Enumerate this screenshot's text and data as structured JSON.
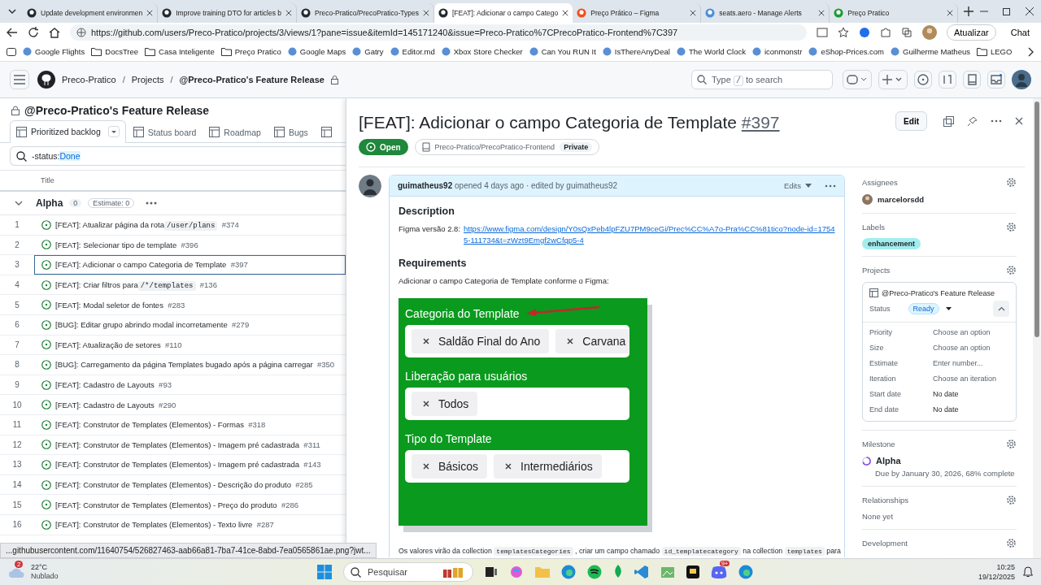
{
  "browser": {
    "tabs": [
      {
        "title": "Update development environmen",
        "kind": "github",
        "selected": false
      },
      {
        "title": "Improve training DTO for articles b",
        "kind": "github",
        "selected": false
      },
      {
        "title": "Preco-Pratico/PrecoPratico-Types",
        "kind": "github",
        "selected": false
      },
      {
        "title": "[FEAT]: Adicionar o campo Catego",
        "kind": "github",
        "selected": true
      },
      {
        "title": "Preço Prático – Figma",
        "kind": "figma",
        "selected": false
      },
      {
        "title": "seats.aero - Manage Alerts",
        "kind": "seats",
        "selected": false
      },
      {
        "title": "Preço Pratico",
        "kind": "preco",
        "selected": false
      }
    ],
    "url": "https://github.com/users/Preco-Pratico/projects/3/views/1?pane=issue&itemId=145171240&issue=Preco-Pratico%7CPrecoPratico-Frontend%7C397",
    "update_button": "Atualizar",
    "chat_button": "Chat",
    "bookmarks": [
      {
        "label": "Google Flights",
        "kind": "site"
      },
      {
        "label": "DocsTree",
        "kind": "folder"
      },
      {
        "label": "Casa Inteligente",
        "kind": "folder"
      },
      {
        "label": "Preço Pratico",
        "kind": "folder"
      },
      {
        "label": "Google Maps",
        "kind": "site"
      },
      {
        "label": "Gatry",
        "kind": "site"
      },
      {
        "label": "Editor.md",
        "kind": "site"
      },
      {
        "label": "Xbox Store Checker",
        "kind": "site"
      },
      {
        "label": "Can You RUN It",
        "kind": "site"
      },
      {
        "label": "IsThereAnyDeal",
        "kind": "site"
      },
      {
        "label": "The World Clock",
        "kind": "site"
      },
      {
        "label": "iconmonstr",
        "kind": "site"
      },
      {
        "label": "eShop-Prices.com",
        "kind": "site"
      },
      {
        "label": "Guilherme Matheus",
        "kind": "site"
      },
      {
        "label": "LEGO",
        "kind": "folder"
      }
    ]
  },
  "github": {
    "breadcrumbs": [
      {
        "kind": "link",
        "text": "Preco-Pratico"
      },
      {
        "kind": "separator",
        "text": "/"
      },
      {
        "kind": "link",
        "text": "Projects"
      },
      {
        "kind": "separator",
        "text": "/"
      },
      {
        "kind": "current",
        "text": "@Preco-Pratico's Feature Release"
      }
    ],
    "search": {
      "before": "Type",
      "key": "/",
      "after": "to search"
    }
  },
  "project": {
    "title": "@Preco-Pratico's Feature Release",
    "views": [
      {
        "label": "Prioritized backlog",
        "selected": true
      },
      {
        "label": "Status board",
        "selected": false
      },
      {
        "label": "Roadmap",
        "selected": false
      },
      {
        "label": "Bugs",
        "selected": false
      }
    ],
    "filter": {
      "prefix": "-status:",
      "value": "Done"
    },
    "column": "Title",
    "group": {
      "name": "Alpha",
      "count": "0",
      "estimate": "Estimate: 0"
    },
    "rows": [
      {
        "num": "1",
        "title": "[FEAT]: Atualizar página da rota",
        "code": "/user/plans",
        "number": "#374",
        "selected": false
      },
      {
        "num": "2",
        "title": "[FEAT]: Selecionar tipo de template",
        "number": "#396",
        "selected": false
      },
      {
        "num": "3",
        "title": "[FEAT]: Adicionar o campo Categoria de Template",
        "number": "#397",
        "selected": true
      },
      {
        "num": "4",
        "title": "[FEAT]: Criar filtros para",
        "code": "/*/templates",
        "number": "#136",
        "selected": false
      },
      {
        "num": "5",
        "title": "[FEAT]: Modal seletor de fontes",
        "number": "#283",
        "selected": false
      },
      {
        "num": "6",
        "title": "[BUG]: Editar grupo abrindo modal incorretamente",
        "number": "#279",
        "selected": false
      },
      {
        "num": "7",
        "title": "[FEAT]: Atualização de setores",
        "number": "#110",
        "selected": false
      },
      {
        "num": "8",
        "title": "[BUG]: Carregamento da página Templates bugado após a página carregar",
        "number": "#350",
        "selected": false
      },
      {
        "num": "9",
        "title": "[FEAT]: Cadastro de Layouts",
        "number": "#93",
        "selected": false
      },
      {
        "num": "10",
        "title": "[FEAT]: Cadastro de Layouts",
        "number": "#290",
        "selected": false
      },
      {
        "num": "11",
        "title": "[FEAT]: Construtor de Templates (Elementos) - Formas",
        "number": "#318",
        "selected": false
      },
      {
        "num": "12",
        "title": "[FEAT]: Construtor de Templates (Elementos) - Imagem pré cadastrada",
        "number": "#311",
        "selected": false
      },
      {
        "num": "13",
        "title": "[FEAT]: Construtor de Templates (Elementos) - Imagem pré cadastrada",
        "number": "#143",
        "selected": false
      },
      {
        "num": "14",
        "title": "[FEAT]: Construtor de Templates (Elementos) - Descrição do produto",
        "number": "#285",
        "selected": false
      },
      {
        "num": "15",
        "title": "[FEAT]: Construtor de Templates (Elementos) - Preço do produto",
        "number": "#286",
        "selected": false
      },
      {
        "num": "16",
        "title": "[FEAT]: Construtor de Templates (Elementos) - Texto livre",
        "number": "#287",
        "selected": false
      }
    ]
  },
  "issue": {
    "title": "[FEAT]: Adicionar o campo Categoria de Template",
    "number": "#397",
    "edit_button": "Edit",
    "state": "Open",
    "repo": "Preco-Pratico/PrecoPratico-Frontend",
    "visibility": "Private",
    "comment": {
      "author": "guimatheus92",
      "meta": "opened 4 days ago · edited by guimatheus92",
      "edits": "Edits",
      "description_heading": "Description",
      "figma_label": "Figma versão 2.8:",
      "figma_link": "https://www.figma.com/design/Y0sQxPeb4lpFZU7PM9ceGi/Prec%CC%A7o-Pra%CC%81tico?node-id=17545-111734&t=zWzt9Emgf2wCfqp5-4",
      "requirements_heading": "Requirements",
      "requirements_text": "Adicionar o campo Categoria de Template conforme o Figma:",
      "mockup": [
        {
          "label": "Categoria do Template",
          "chips": [
            "Saldão Final do Ano",
            "Carvana"
          ]
        },
        {
          "label": "Liberação para usuários",
          "chips": [
            "Todos"
          ]
        },
        {
          "label": "Tipo do Template",
          "chips": [
            "Básicos",
            "Intermediários"
          ]
        }
      ],
      "footer": [
        {
          "kind": "text",
          "text": "Os valores virão da collection "
        },
        {
          "kind": "code",
          "text": "templatesCategories"
        },
        {
          "kind": "text",
          "text": " , criar um campo chamado "
        },
        {
          "kind": "code",
          "text": "id_templatecategory"
        },
        {
          "kind": "text",
          "text": " na collection "
        },
        {
          "kind": "code",
          "text": "templates"
        },
        {
          "kind": "text",
          "text": " para"
        }
      ]
    },
    "sidebar": {
      "assignees_heading": "Assignees",
      "assignee": "marcelorsdd",
      "labels_heading": "Labels",
      "labels": [
        {
          "text": "enhancement",
          "color": "#a2eeef"
        }
      ],
      "projects_heading": "Projects",
      "project": {
        "name": "@Preco-Pratico's Feature Release",
        "status_label": "Status",
        "status": "Ready",
        "fields": [
          {
            "label": "Priority",
            "value": "Choose an option",
            "placeholder": true
          },
          {
            "label": "Size",
            "value": "Choose an option",
            "placeholder": true
          },
          {
            "label": "Estimate",
            "value": "Enter number...",
            "placeholder": true
          },
          {
            "label": "Iteration",
            "value": "Choose an iteration",
            "placeholder": true
          },
          {
            "label": "Start date",
            "value": "No date",
            "placeholder": false
          },
          {
            "label": "End date",
            "value": "No date",
            "placeholder": false
          }
        ]
      },
      "milestone_heading": "Milestone",
      "milestone": "Alpha",
      "milestone_due": "Due by January 30, 2026, 68% complete",
      "relationships_heading": "Relationships",
      "relationships": "None yet",
      "development_heading": "Development"
    }
  },
  "status_url": "...githubusercontent.com/11640754/526827463-aab66a81-7ba7-41ce-8abd-7ea0565861ae.png?jwt...",
  "taskbar": {
    "weather_badge": "2",
    "temperature": "22°C",
    "condition": "Nublado",
    "search": "Pesquisar",
    "discord_badge": "9+",
    "time": "10:25",
    "date": "19/12/2025"
  }
}
